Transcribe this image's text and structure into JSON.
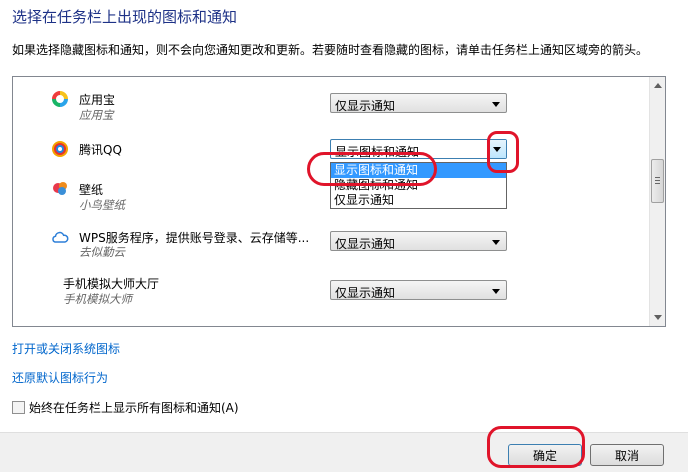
{
  "header": {
    "title": "选择在任务栏上出现的图标和通知",
    "description": "如果选择隐藏图标和通知，则不会向您通知更改和更新。若要随时查看隐藏的图标，请单击任务栏上通知区域旁的箭头。"
  },
  "list": {
    "rows": [
      {
        "name": "应用宝",
        "subtitle": "应用宝",
        "icon": "yingyongbao-icon",
        "value": "仅显示通知"
      },
      {
        "name": "腾讯QQ",
        "subtitle": "",
        "icon": "qq-icon",
        "value": "显示图标和通知"
      },
      {
        "name": "壁纸",
        "subtitle": "小鸟壁纸",
        "icon": "wallpaper-icon",
        "value": ""
      },
      {
        "name": "WPS服务程序，提供账号登录、云存储等...",
        "subtitle": "去似勤云",
        "icon": "cloud-icon",
        "value": "仅显示通知"
      },
      {
        "name": "手机模拟大师大厅",
        "subtitle": "手机模拟大师",
        "icon": "",
        "value": "仅显示通知"
      }
    ],
    "dropdown_options": [
      "显示图标和通知",
      "隐藏图标和通知",
      "仅显示通知"
    ],
    "selected_option": "显示图标和通知"
  },
  "links": {
    "system_icons": "打开或关闭系统图标",
    "restore_defaults": "还原默认图标行为"
  },
  "checkbox": {
    "label": "始终在任务栏上显示所有图标和通知(A)",
    "checked": false
  },
  "footer": {
    "ok_label": "确定",
    "cancel_label": "取消"
  },
  "colors": {
    "title": "#1e3287",
    "link": "#0066cc",
    "selection": "#3399ff",
    "annotation": "#e0142a"
  }
}
